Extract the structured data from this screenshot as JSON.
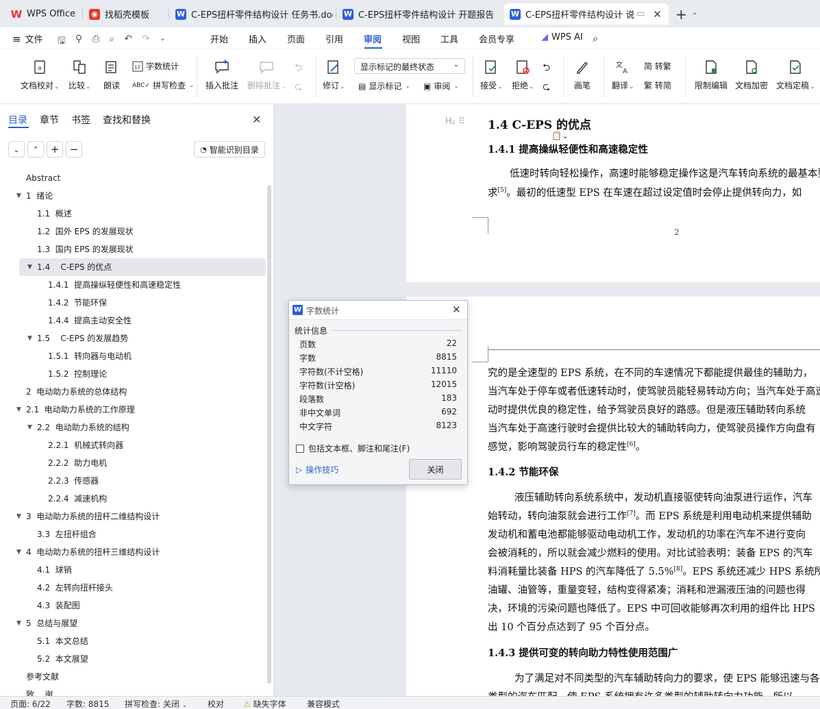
{
  "tabs": [
    {
      "label": "WPS Office",
      "icon": "wps-logo-icon"
    },
    {
      "label": "找稻壳模板",
      "icon": "docer-icon"
    },
    {
      "label": "C-EPS扭杆零件结构设计 任务书.doc",
      "icon": "word-doc-icon"
    },
    {
      "label": "C-EPS扭杆零件结构设计 开题报告.doc",
      "icon": "word-doc-icon"
    },
    {
      "label": "C-EPS扭杆零件结构设计 说明书",
      "icon": "word-doc-icon"
    }
  ],
  "menu": {
    "file": "文件",
    "items": [
      "开始",
      "插入",
      "页面",
      "引用",
      "审阅",
      "视图",
      "工具",
      "会员专享"
    ],
    "active": "审阅",
    "ai": "WPS AI"
  },
  "ribbon": {
    "proofread": "文档校对",
    "compare": "比较",
    "read_aloud": "朗读",
    "word_count": "字数统计",
    "spell_check": "拼写检查",
    "insert_comment": "插入批注",
    "delete_comment": "删除批注",
    "revise": "修订",
    "markup_state": "显示标记的最终状态",
    "show_markup": "显示标记",
    "review": "审阅",
    "accept": "接受",
    "reject": "拒绝",
    "pen": "画笔",
    "translate": "翻译",
    "to_traditional": "简 转繁",
    "to_simplified": "繁 转简",
    "restrict_edit": "限制编辑",
    "encrypt": "文档加密",
    "finalize": "文档定稿"
  },
  "sidebar": {
    "tabs": [
      "目录",
      "章节",
      "书签",
      "查找和替换"
    ],
    "smart_toc": "智能识别目录",
    "toc": [
      {
        "label": "Abstract",
        "level": 1,
        "arrow": false
      },
      {
        "label": "1  绪论",
        "level": 0,
        "arrow": true
      },
      {
        "label": "1.1  概述",
        "level": 2,
        "arrow": false
      },
      {
        "label": "1.2  国外 EPS 的发展现状",
        "level": 2,
        "arrow": false
      },
      {
        "label": "1.3  国内 EPS 的发展现状",
        "level": 2,
        "arrow": false
      },
      {
        "label": "1.4    C-EPS 的优点",
        "level": 1.4,
        "arrow": true,
        "selected": true
      },
      {
        "label": "1.4.1  提高操纵轻便性和高速稳定性",
        "level": 3,
        "arrow": false
      },
      {
        "label": "1.4.2  节能环保",
        "level": 3,
        "arrow": false
      },
      {
        "label": "1.4.4  提高主动安全性",
        "level": 3,
        "arrow": false
      },
      {
        "label": "1.5    C-EPS 的发展趋势",
        "level": 1.4,
        "arrow": true
      },
      {
        "label": "1.5.1  转向器与电动机",
        "level": 3,
        "arrow": false
      },
      {
        "label": "1.5.2  控制理论",
        "level": 3,
        "arrow": false
      },
      {
        "label": "2  电动助力系统的总体结构",
        "level": 1,
        "arrow": false
      },
      {
        "label": "2.1  电动助力系统的工作原理",
        "level": 0,
        "arrow": true
      },
      {
        "label": "2.2  电动助力系统的结构",
        "level": 1.4,
        "arrow": true
      },
      {
        "label": "2.2.1  机械式转向器",
        "level": 3,
        "arrow": false
      },
      {
        "label": "2.2.2  助力电机",
        "level": 3,
        "arrow": false
      },
      {
        "label": "2.2.3  传感器",
        "level": 3,
        "arrow": false
      },
      {
        "label": "2.2.4  减速机构",
        "level": 3,
        "arrow": false
      },
      {
        "label": "3  电动助力系统的扭杆二维结构设计",
        "level": 0,
        "arrow": true
      },
      {
        "label": "3.3  左扭杆组合",
        "level": 2,
        "arrow": false
      },
      {
        "label": "4  电动助力系统的扭杆三维结构设计",
        "level": 0,
        "arrow": true
      },
      {
        "label": "4.1  球销",
        "level": 2,
        "arrow": false
      },
      {
        "label": "4.2  左转向扭杆接头",
        "level": 2,
        "arrow": false
      },
      {
        "label": "4.3  装配图",
        "level": 2,
        "arrow": false
      },
      {
        "label": "5  总结与展望",
        "level": 0,
        "arrow": true
      },
      {
        "label": "5.1  本文总结",
        "level": 2,
        "arrow": false
      },
      {
        "label": "5.2  本文展望",
        "level": 2,
        "arrow": false
      },
      {
        "label": "参考文献",
        "level": 1,
        "arrow": false
      },
      {
        "label": "致    谢",
        "level": 1,
        "arrow": false
      }
    ]
  },
  "document": {
    "h2": "1.4   C-EPS 的优点",
    "h3_1": "1.4.1  提高操纵轻便性和高速稳定性",
    "p1_1": "低速时转向轻松操作，高速时能够稳定操作这是汽车转向系统的最基本要",
    "p1_2a": "求",
    "p1_2ref": "[5]",
    "p1_2b": "。最初的低速型 EPS 在车速在超过设定值时会停止提供转向力，如",
    "page_number": "2",
    "p2_1": "究的是全速型的 EPS 系统，在不同的车速情况下都能提供最佳的辅助力，",
    "p2_2": "当汽车处于停车或者低速转动时，使驾驶员能轻易转动方向；当汽车处于高速",
    "p2_3": "动时提供优良的稳定性，给予驾驶员良好的路感。但是液压辅助转向系统",
    "p2_4": "当汽车处于高速行驶时会提供比较大的辅助转向力，使驾驶员操作方向盘有",
    "p2_5a": "感觉，影响驾驶员行车的稳定性",
    "p2_5ref": "[6]",
    "p2_5b": "。",
    "h3_2": "1.4.2  节能环保",
    "p3_1": "液压辅助转向系统系统中，发动机直接驱使转向油泵进行运作，汽车",
    "p3_2a": "始转动，转向油泵就会进行工作",
    "p3_2ref": "[7]",
    "p3_2b": "。而 EPS 系统是利用电动机来提供辅助",
    "p3_3": "发动机和蓄电池都能够驱动电动机工作，发动机的功率在汽车不进行变向",
    "p3_4": "会被消耗的，所以就会减少燃料的使用。对比试验表明：装备 EPS 的汽车",
    "p3_5a": "料消耗量比装备 HPS 的汽车降低了 5.5%",
    "p3_5ref": "[8]",
    "p3_5b": "。EPS 系统还减少 HPS 系统所需",
    "p3_6": "油罐、油管等，重量变轻，结构变得紧凑；消耗和泄漏液压油的问题也得",
    "p3_7": "决，环境的污染问题也降低了。EPS 中可回收能够再次利用的组件比 HPS",
    "p3_8": "出 10 个百分点达到了 95 个百分点。",
    "h3_3": "1.4.3  提供可变的转向助力特性使用范围广",
    "p4_1": "为了满足对不同类型的汽车辅助转向力的要求，使 EPS 能够迅速与各",
    "p4_2": "类型的汽车匹配，使 EPS 系统拥有许多类型的辅助转向力功能，所以"
  },
  "dialog": {
    "title": "字数统计",
    "section": "统计信息",
    "rows": [
      {
        "label": "页数",
        "value": "22"
      },
      {
        "label": "字数",
        "value": "8815"
      },
      {
        "label": "字符数(不计空格)",
        "value": "11110"
      },
      {
        "label": "字符数(计空格)",
        "value": "12015"
      },
      {
        "label": "段落数",
        "value": "183"
      },
      {
        "label": "非中文单词",
        "value": "692"
      },
      {
        "label": "中文字符",
        "value": "8123"
      }
    ],
    "checkbox_label": "包括文本框、脚注和尾注(F)",
    "checkbox_checked": false,
    "tips": "操作技巧",
    "close": "关闭"
  },
  "status": {
    "page": "页面: 6/22",
    "words": "字数: 8815",
    "spell": "拼写检查: 关闭",
    "proof": "校对",
    "missing_font": "缺失字体",
    "compat": "兼容模式"
  },
  "colors": {
    "accent": "#2a63d4",
    "wps_red": "#e8382a",
    "word_blue": "#2b5fd9"
  }
}
